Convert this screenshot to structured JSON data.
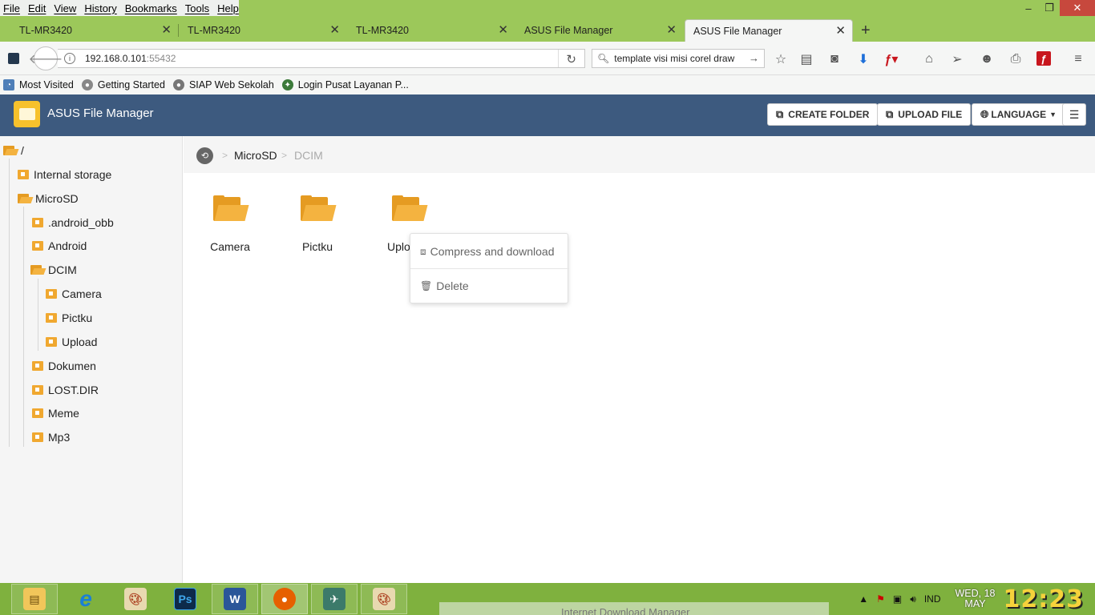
{
  "browser": {
    "menu": [
      "File",
      "Edit",
      "View",
      "History",
      "Bookmarks",
      "Tools",
      "Help"
    ],
    "window_controls": {
      "minimize": "–",
      "restore": "❐",
      "close": "✕"
    },
    "tabs": [
      {
        "label": "TL-MR3420",
        "active": false
      },
      {
        "label": "TL-MR3420",
        "active": false
      },
      {
        "label": "TL-MR3420",
        "active": false
      },
      {
        "label": "ASUS File Manager",
        "active": false
      },
      {
        "label": "ASUS File Manager",
        "active": true
      }
    ],
    "new_tab": "+",
    "url": {
      "host": "192.168.0.101",
      "port": ":55432"
    },
    "search": {
      "value": "template visi misi corel draw"
    },
    "bookmarks": [
      {
        "label": "Most Visited",
        "icon": "most-visited-icon"
      },
      {
        "label": "Getting Started",
        "icon": "firefox-icon"
      },
      {
        "label": "SIAP Web Sekolah",
        "icon": "globe-icon"
      },
      {
        "label": "Login Pusat Layanan P...",
        "icon": "emblem-icon"
      }
    ],
    "colors": {
      "chrome": "#9cc85a",
      "taskbar": "#7fb13e"
    }
  },
  "app": {
    "title": "ASUS File Manager",
    "buttons": {
      "create_folder": "CREATE FOLDER",
      "upload_file": "UPLOAD FILE",
      "language": "LANGUAGE"
    },
    "colors": {
      "header": "#3d5a7f",
      "folder": "#f4b340"
    }
  },
  "tree": {
    "root": "/",
    "items": [
      "Internal storage",
      "MicroSD",
      ".android_obb",
      "Android",
      "DCIM",
      "Camera",
      "Pictku",
      "Upload",
      "Dokumen",
      "LOST.DIR",
      "Meme",
      "Mp3"
    ]
  },
  "breadcrumb": {
    "parent": "MicroSD",
    "current": "DCIM",
    "separator": ">"
  },
  "files": [
    "Camera",
    "Pictku",
    "Uplo"
  ],
  "context_menu": {
    "compress": "Compress and download",
    "delete": "Delete"
  },
  "taskbar": {
    "apps": [
      "File Explorer",
      "Internet Explorer",
      "Paint",
      "Photoshop",
      "Word",
      "Firefox",
      "Satellite",
      "Paint"
    ],
    "lang": "IND",
    "date_day": "WED, 18",
    "date_month": "MAY",
    "time": "12:23"
  },
  "popup": {
    "label": "Internet Download Manager"
  }
}
